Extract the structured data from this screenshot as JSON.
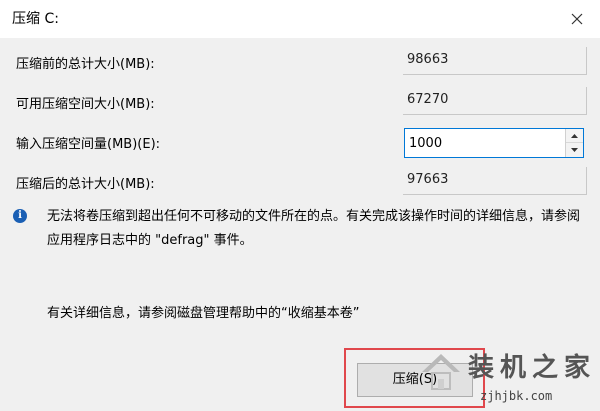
{
  "window": {
    "title": "压缩 C:"
  },
  "fields": [
    {
      "label": "压缩前的总计大小(MB):",
      "value": "98663"
    },
    {
      "label": "可用压缩空间大小(MB):",
      "value": "67270"
    },
    {
      "label": "输入压缩空间量(MB)(E):",
      "value": "1000"
    },
    {
      "label": "压缩后的总计大小(MB):",
      "value": "97663"
    }
  ],
  "info": {
    "icon": "info-icon",
    "message": "无法将卷压缩到超出任何不可移动的文件所在的点。有关完成该操作时间的详细信息，请参阅应用程序日志中的 \"defrag\" 事件。"
  },
  "help": {
    "message": "有关详细信息，请参阅磁盘管理帮助中的“收缩基本卷”"
  },
  "buttons": {
    "compress": "压缩(S)"
  },
  "watermark": {
    "title": "装机之家",
    "url": "zjhjbk.com"
  },
  "colors": {
    "focus_border": "#0078d7",
    "highlight": "#e0474c",
    "info_icon": "#1a5fb4"
  }
}
